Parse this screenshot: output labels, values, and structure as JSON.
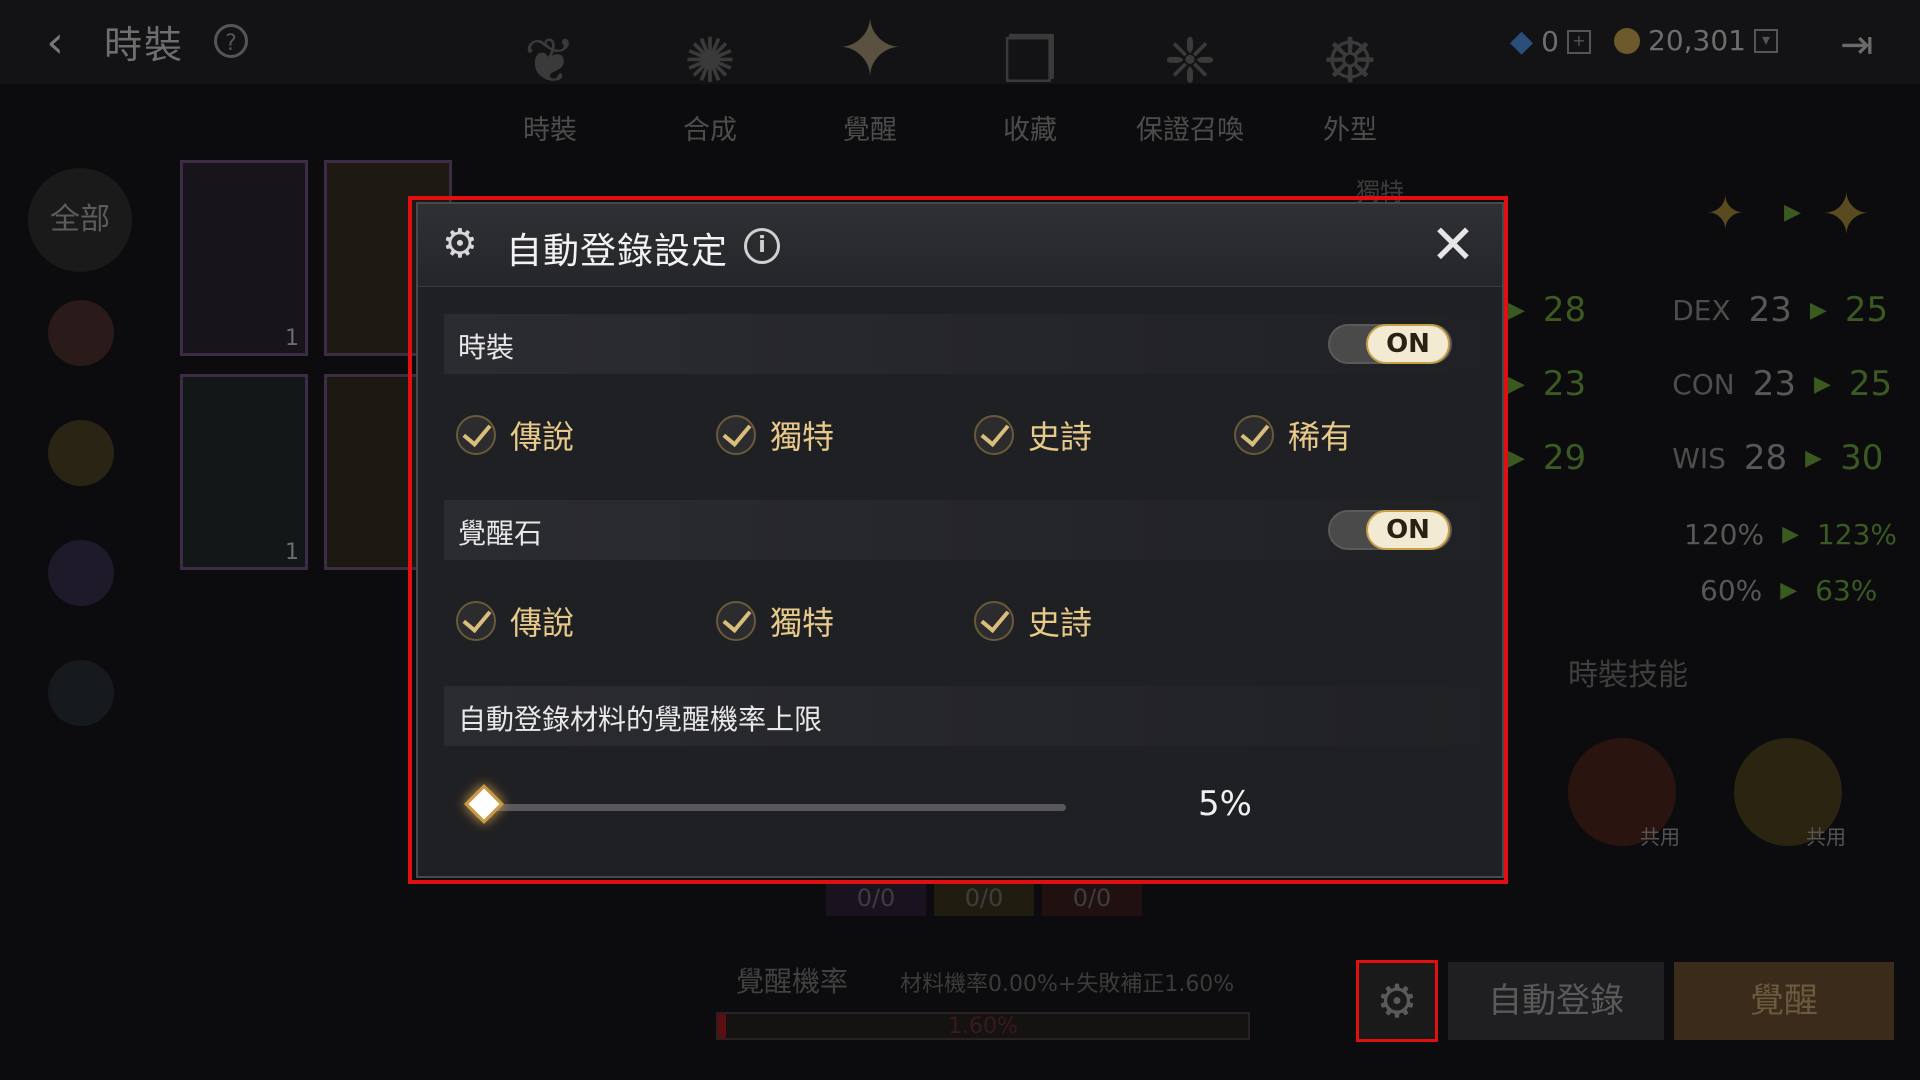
{
  "header": {
    "title": "時裝",
    "help_symbol": "?",
    "back_symbol": "‹",
    "exit_symbol": "⇥"
  },
  "nav_tabs": [
    {
      "label": "時裝"
    },
    {
      "label": "合成"
    },
    {
      "label": "覺醒",
      "active": true
    },
    {
      "label": "收藏"
    },
    {
      "label": "保證召喚"
    },
    {
      "label": "外型"
    }
  ],
  "currency": {
    "gems": "0",
    "gold": "20,301"
  },
  "sidebar": {
    "all_label": "全部"
  },
  "cards": [
    {
      "count": "1"
    },
    {
      "count": ""
    },
    {
      "count": "1"
    },
    {
      "count": ""
    }
  ],
  "stats": {
    "section_label": "獨特",
    "rows": [
      {
        "a_to": "28",
        "label": "DEX",
        "from": "23",
        "to": "25"
      },
      {
        "a_to": "23",
        "label": "CON",
        "from": "23",
        "to": "25"
      },
      {
        "a_to": "29",
        "label": "WIS",
        "from": "28",
        "to": "30"
      }
    ],
    "pct_rows": [
      {
        "from": "120%",
        "to": "123%"
      },
      {
        "from": "60%",
        "to": "63%"
      }
    ],
    "skills_title": "時裝技能",
    "skill_tag": "共用"
  },
  "materials": [
    "0/0",
    "0/0",
    "0/0"
  ],
  "awaken_rate": {
    "label": "覺醒機率",
    "detail": "材料機率0.00%+失敗補正1.60%",
    "bar_text": "1.60%",
    "percent": 1.6
  },
  "bottom_buttons": {
    "auto_register": "自動登錄",
    "awaken": "覺醒"
  },
  "dialog": {
    "title": "自動登錄設定",
    "info_symbol": "i",
    "close_symbol": "✕",
    "sections": [
      {
        "label": "時裝",
        "toggle": "ON",
        "options": [
          "傳說",
          "獨特",
          "史詩",
          "稀有"
        ]
      },
      {
        "label": "覺醒石",
        "toggle": "ON",
        "options": [
          "傳說",
          "獨特",
          "史詩"
        ]
      }
    ],
    "limit": {
      "label": "自動登錄材料的覺醒機率上限",
      "value_text": "5%",
      "value": 5
    }
  },
  "colors": {
    "accent_gold": "#e7c98a",
    "highlight_red": "#e01010"
  }
}
